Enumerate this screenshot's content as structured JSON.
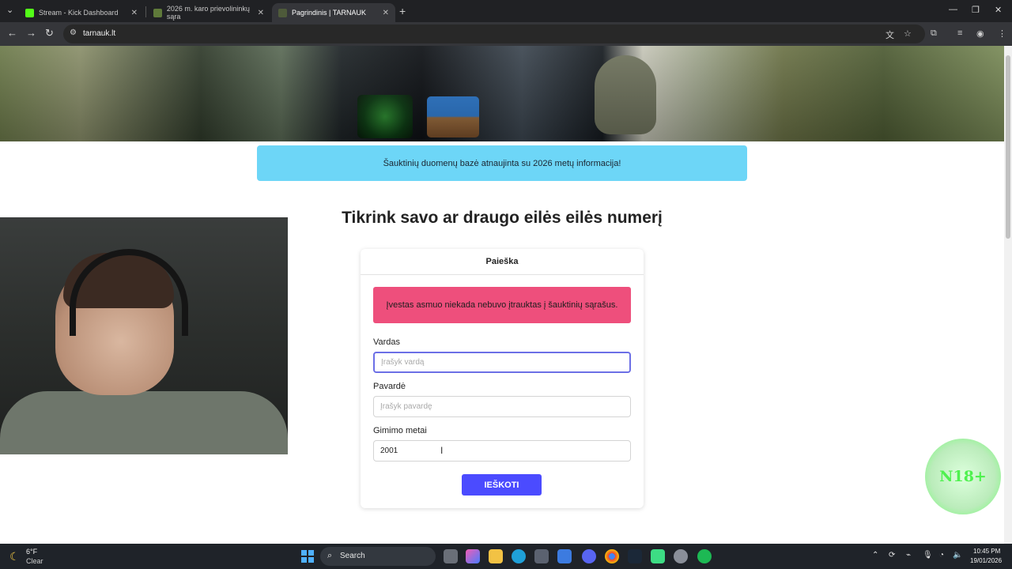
{
  "browser": {
    "tabs": [
      {
        "title": "Stream - Kick Dashboard",
        "favicon_color": "#53fc18",
        "active": false
      },
      {
        "title": "2026 m. karo prievolininkų sąra",
        "favicon_color": "#5f7a3a",
        "active": false
      },
      {
        "title": "Pagrindinis | TARNAUK",
        "favicon_color": "#4e5a3a",
        "active": true
      }
    ],
    "url": "tarnauk.lt"
  },
  "page": {
    "notice": "Šauktinių duomenų bazė atnaujinta su 2026 metų informacija!",
    "headline": "Tikrink savo ar draugo eilės eilės numerį",
    "card": {
      "title": "Paieška",
      "alert": "Įvestas asmuo niekada nebuvo įtrauktas į šauktinių sąrašus.",
      "fields": {
        "first_name": {
          "label": "Vardas",
          "placeholder": "Įrašyk vardą",
          "value": ""
        },
        "last_name": {
          "label": "Pavardė",
          "placeholder": "Įrašyk pavardę",
          "value": ""
        },
        "birth_year": {
          "label": "Gimimo metai",
          "placeholder": "",
          "value": "2001"
        }
      },
      "button": "IEŠKOTI"
    },
    "colors": {
      "notice": "#6dd6f7",
      "alert": "#ee4f7c",
      "button": "#4b4bff"
    }
  },
  "overlay": {
    "badge": "N18+"
  },
  "taskbar": {
    "weather": {
      "temp": "6°F",
      "condition": "Clear"
    },
    "search": "Search",
    "clock": {
      "time": "10:45 PM",
      "date": "19/01/2026"
    }
  }
}
